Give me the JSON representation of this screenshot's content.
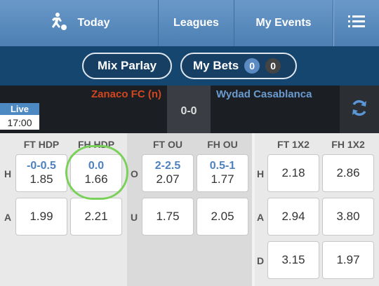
{
  "nav": {
    "today": "Today",
    "leagues": "Leagues",
    "my_events": "My Events",
    "today_icon": "soccer-player-icon",
    "menu_icon": "list-menu-icon"
  },
  "betbar": {
    "mix_parlay": "Mix Parlay",
    "my_bets": "My Bets",
    "badge_a": "0",
    "badge_b": "0"
  },
  "match": {
    "live": "Live",
    "time": "17:00",
    "home": "Zanaco FC (n)",
    "score": "0-0",
    "away": "Wydad Casablanca",
    "refresh_icon": "refresh-icon"
  },
  "hdp": {
    "headers": [
      "FT HDP",
      "FH HDP"
    ],
    "row_labels": [
      "H",
      "A"
    ],
    "home": [
      {
        "line": "-0-0.5",
        "odd": "1.85"
      },
      {
        "line": "0.0",
        "odd": "1.66"
      }
    ],
    "away": [
      "1.99",
      "2.21"
    ]
  },
  "ou": {
    "headers": [
      "FT OU",
      "FH OU"
    ],
    "row_labels": [
      "O",
      "U"
    ],
    "over": [
      {
        "line": "2-2.5",
        "odd": "2.07"
      },
      {
        "line": "0.5-1",
        "odd": "1.77"
      }
    ],
    "under": [
      "1.75",
      "2.05"
    ]
  },
  "x12": {
    "headers": [
      "FT 1X2",
      "FH 1X2"
    ],
    "row_labels": [
      "H",
      "A",
      "D"
    ],
    "home": [
      "2.18",
      "2.86"
    ],
    "away": [
      "2.94",
      "3.80"
    ],
    "draw": [
      "3.15",
      "1.97"
    ]
  },
  "colors": {
    "nav": "#5a8bbf",
    "betbar": "#15466f",
    "home_team": "#d2461f",
    "away_team": "#6a9bd0",
    "line": "#4d81c0",
    "highlight": "#7ad15a"
  }
}
